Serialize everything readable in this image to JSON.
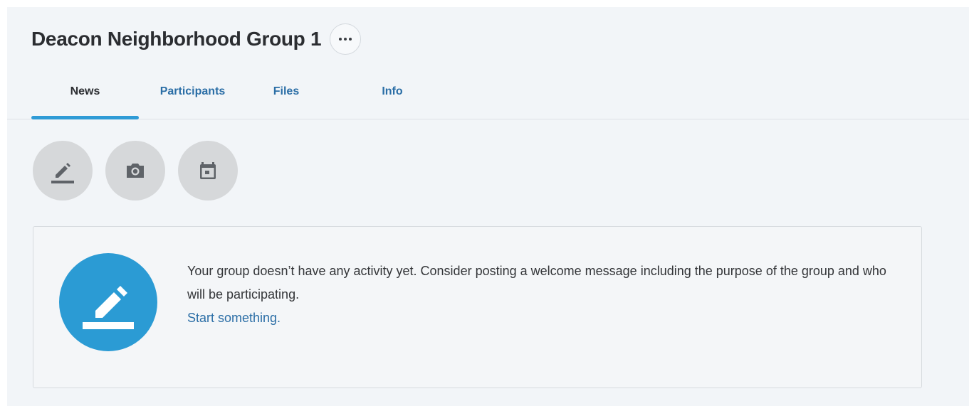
{
  "header": {
    "title": "Deacon Neighborhood Group 1",
    "more_button_icon": "more-horizontal-icon"
  },
  "tabs": [
    {
      "label": "News",
      "active": true
    },
    {
      "label": "Participants",
      "active": false
    },
    {
      "label": "Files",
      "active": false
    },
    {
      "label": "Info",
      "active": false
    }
  ],
  "actions": [
    {
      "icon": "pencil-icon"
    },
    {
      "icon": "camera-icon"
    },
    {
      "icon": "calendar-icon"
    }
  ],
  "empty_state": {
    "icon": "pencil-icon",
    "message": "Your group doesn’t have any activity yet. Consider posting a welcome message including the purpose of the group and who will be participating.",
    "link_label": "Start something."
  },
  "colors": {
    "accent": "#2b9bd4",
    "link": "#2b6ea6",
    "tab_indicator": "#2f9bd6",
    "background": "#f2f5f8",
    "action_button": "#d6d8da"
  }
}
